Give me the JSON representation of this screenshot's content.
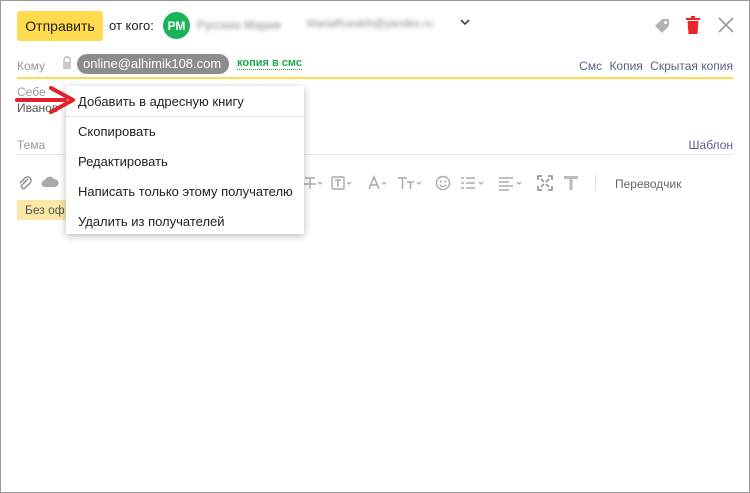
{
  "header": {
    "send_label": "Отправить",
    "from_label": "от кого:",
    "avatar_initials": "РМ",
    "sender_name": "Русских Мария",
    "sender_email": "MariaRusskih@yandex.ru"
  },
  "recipients": {
    "to_label": "Кому",
    "chip_email": "online@alhimik108.com",
    "sms_copy": "копия в смс",
    "links": [
      "Смс",
      "Копия",
      "Скрытая копия"
    ]
  },
  "self_row": {
    "label": "Себе",
    "sub": "Иванов"
  },
  "subject": {
    "label": "Тема",
    "template_link": "Шаблон"
  },
  "toolbar": {
    "translator_label": "Переводчик"
  },
  "notice": {
    "text": "Без оф"
  },
  "context_menu": {
    "items": [
      "Добавить в адресную книгу",
      "Скопировать",
      "Редактировать",
      "Написать только этому получателю",
      "Удалить из получателей"
    ]
  },
  "colors": {
    "send_button": "#ffdb4d",
    "avatar": "#19b358",
    "trash": "#e8262c",
    "sms_copy": "#1fa84b",
    "arrow": "#e0202c"
  }
}
